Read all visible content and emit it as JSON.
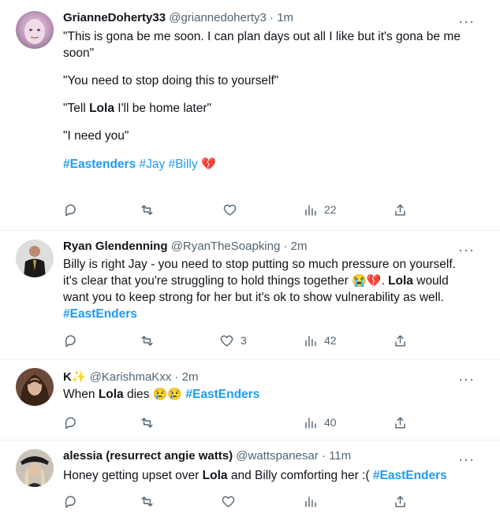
{
  "tweets": [
    {
      "name": "GrianneDoherty33",
      "handle": "@griannedoherty3",
      "sep": "·",
      "time": "1m",
      "lines": [
        "\"This is gona be me soon. I can plan days out all I like but it's gona be me soon\"",
        "\"You need to stop doing this to yourself\"",
        "\"Tell ",
        "Lola",
        " I'll be home later\"",
        "\"I need you\""
      ],
      "tags": [
        "#Eastenders",
        "#Jay",
        "#Billy"
      ],
      "tag_emoji": "💔",
      "counts": {
        "reply": "",
        "retweet": "",
        "like": "",
        "views": "22"
      }
    },
    {
      "name": "Ryan Glendenning",
      "handle": "@RyanTheSoapking",
      "sep": "·",
      "time": "2m",
      "text_a": "Billy is right Jay - you need to stop putting so much pressure on yourself. it's clear that you're struggling to hold things together ",
      "emoji": "😭💔",
      "text_b": ". ",
      "bold": "Lola",
      "text_c": " would want you to keep strong for her but it's ok to show vulnerability as well.",
      "tag": "#EastEnders",
      "counts": {
        "reply": "",
        "retweet": "",
        "like": "3",
        "views": "42"
      }
    },
    {
      "name": "K",
      "name_emoji": "✨",
      "handle": "@KarishmaKxx",
      "sep": "·",
      "time": "2m",
      "text_a": "When ",
      "bold": "Lola",
      "text_b": " dies ",
      "emoji": "😢😢",
      "tag": "#EastEnders",
      "counts": {
        "reply": "",
        "retweet": "",
        "like": "",
        "views": "40"
      }
    },
    {
      "name": "alessia (resurrect angie watts)",
      "handle": "@wattspanesar",
      "sep": "·",
      "time": "11m",
      "text_a": "Honey getting upset over ",
      "bold": "Lola",
      "text_b": " and Billy comforting her :( ",
      "tag": "#EastEnders",
      "counts": {
        "reply": "",
        "retweet": "",
        "like": "",
        "views": ""
      }
    }
  ],
  "icons": {
    "more": "more-icon",
    "reply": "reply-icon",
    "retweet": "retweet-icon",
    "like": "heart-icon",
    "views": "views-icon",
    "share": "share-icon"
  },
  "colors": {
    "link": "#1d9bf0",
    "text": "#0f1419",
    "muted": "#536471"
  },
  "more_label": "···"
}
